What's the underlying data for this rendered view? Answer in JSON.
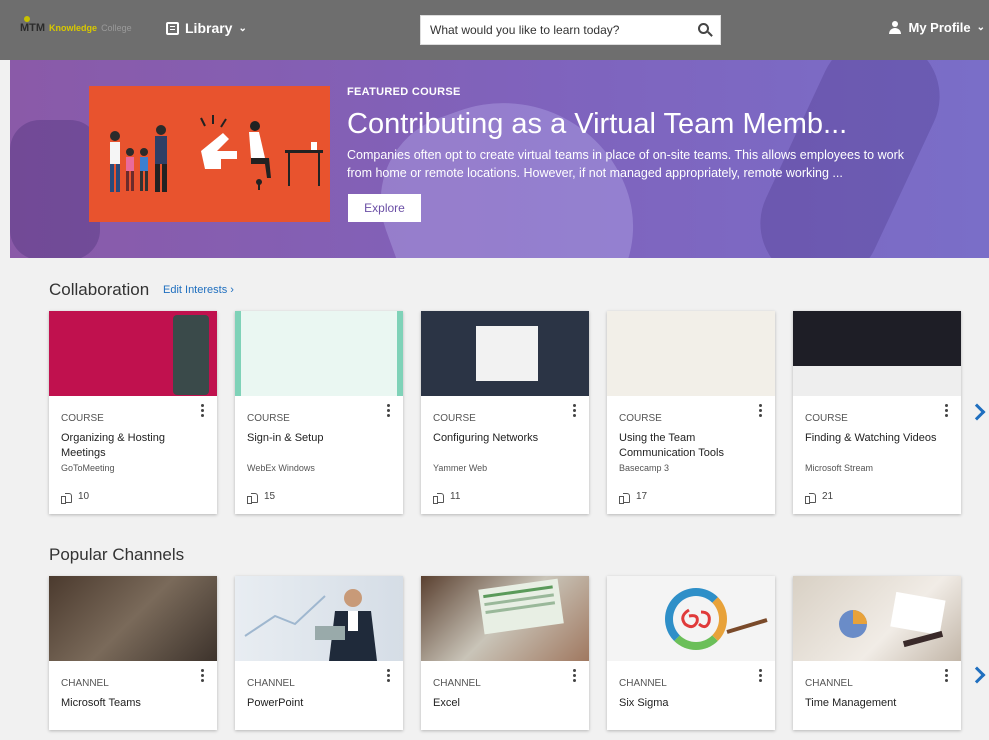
{
  "nav": {
    "logo_mtm": "MTM",
    "logo_knowledge": "Knowledge",
    "logo_college": "College",
    "library_label": "Library",
    "search_placeholder": "What would you like to learn today?",
    "profile_label": "My Profile"
  },
  "featured": {
    "label": "FEATURED COURSE",
    "title": "Contributing as a Virtual Team Memb...",
    "description": "Companies often opt to create virtual teams in place of on-site teams. This allows employees to work from home or remote locations. However, if not managed appropriately, remote working ...",
    "button": "Explore"
  },
  "collaboration": {
    "title": "Collaboration",
    "edit_link": "Edit Interests ›",
    "cards": [
      {
        "type": "COURSE",
        "title": "Organizing & Hosting Meetings",
        "source": "GoToMeeting",
        "likes": "10"
      },
      {
        "type": "COURSE",
        "title": "Sign-in & Setup",
        "source": "WebEx Windows",
        "likes": "15"
      },
      {
        "type": "COURSE",
        "title": "Configuring Networks",
        "source": "Yammer Web",
        "likes": "11"
      },
      {
        "type": "COURSE",
        "title": "Using the Team Communication Tools",
        "source": "Basecamp 3",
        "likes": "17"
      },
      {
        "type": "COURSE",
        "title": "Finding & Watching Videos",
        "source": "Microsoft Stream",
        "likes": "21"
      }
    ]
  },
  "channels": {
    "title": "Popular Channels",
    "cards": [
      {
        "type": "CHANNEL",
        "title": "Microsoft Teams"
      },
      {
        "type": "CHANNEL",
        "title": "PowerPoint"
      },
      {
        "type": "CHANNEL",
        "title": "Excel"
      },
      {
        "type": "CHANNEL",
        "title": "Six Sigma"
      },
      {
        "type": "CHANNEL",
        "title": "Time Management"
      }
    ]
  },
  "colors": {
    "accent": "#1f6fbf",
    "topbar": "#6e6e6e",
    "hero": "#8a5aa8",
    "hero_image": "#e8532e"
  }
}
